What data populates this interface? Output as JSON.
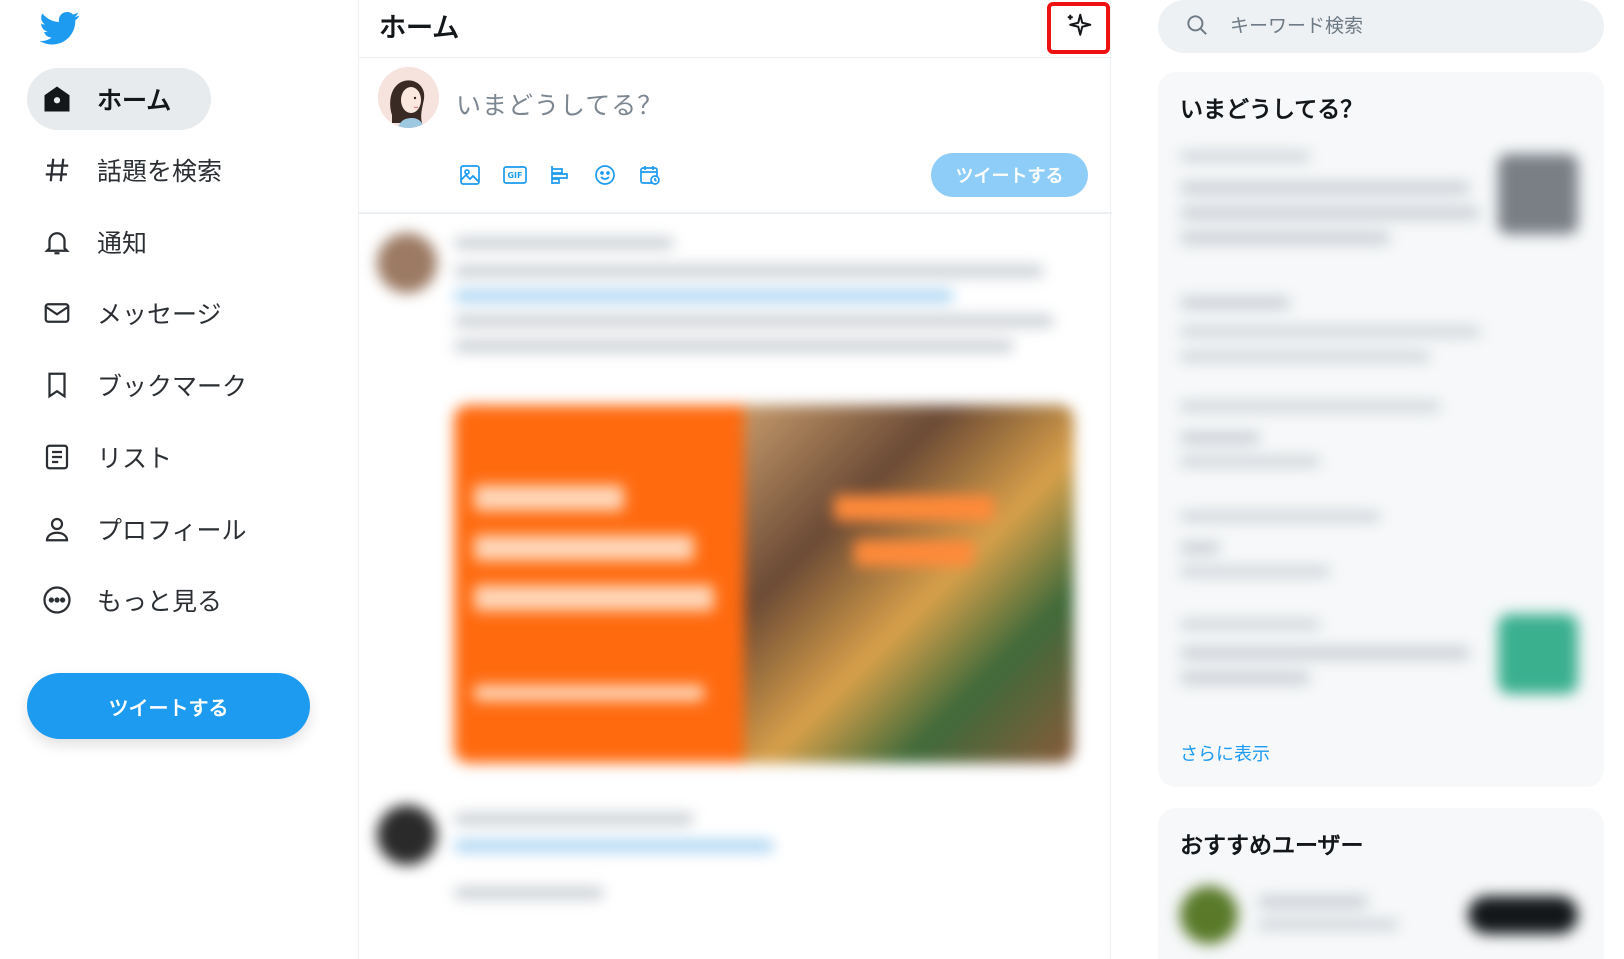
{
  "nav": {
    "items": [
      {
        "label": "ホーム",
        "icon": "home-icon"
      },
      {
        "label": "話題を検索",
        "icon": "hashtag-icon"
      },
      {
        "label": "通知",
        "icon": "bell-icon"
      },
      {
        "label": "メッセージ",
        "icon": "envelope-icon"
      },
      {
        "label": "ブックマーク",
        "icon": "bookmark-icon"
      },
      {
        "label": "リスト",
        "icon": "list-icon"
      },
      {
        "label": "プロフィール",
        "icon": "person-icon"
      },
      {
        "label": "もっと見る",
        "icon": "more-circle-icon"
      }
    ],
    "tweet_button": "ツイートする"
  },
  "header": {
    "title": "ホーム",
    "sparkle_icon": "sparkle-icon"
  },
  "compose": {
    "placeholder": "いまどうしてる？",
    "tools": [
      "image-icon",
      "gif-icon",
      "poll-icon",
      "emoji-icon",
      "schedule-icon"
    ],
    "gif_label": "GIF",
    "tweet_button": "ツイートする"
  },
  "sidebar": {
    "search_placeholder": "キーワード検索",
    "trends_title": "いまどうしてる？",
    "show_more": "さらに表示",
    "suggest_title": "おすすめユーザー"
  },
  "colors": {
    "accent": "#1d9bf0",
    "accent_light": "#8ecdf8",
    "highlight_box": "#ee1111"
  }
}
